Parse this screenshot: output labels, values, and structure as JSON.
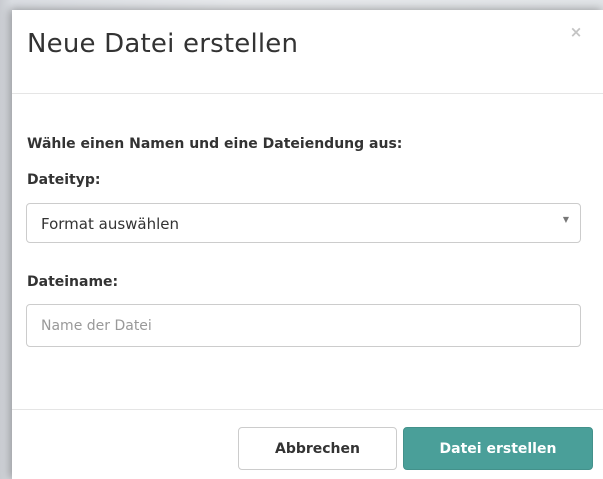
{
  "dialog": {
    "title": "Neue Datei erstellen",
    "close_symbol": "×",
    "instructions": "Wähle einen Namen und eine Dateiendung aus:",
    "filetype": {
      "label": "Dateityp:",
      "selected": "Format auswählen",
      "caret_icon": "caret-down-icon"
    },
    "filename": {
      "label": "Dateiname:",
      "value": "",
      "placeholder": "Name der Datei"
    },
    "buttons": {
      "cancel": "Abbrechen",
      "create": "Datei erstellen"
    }
  },
  "colors": {
    "primary": "#4a9f99",
    "text": "#333333",
    "border": "#cccccc",
    "placeholder": "#999999"
  }
}
